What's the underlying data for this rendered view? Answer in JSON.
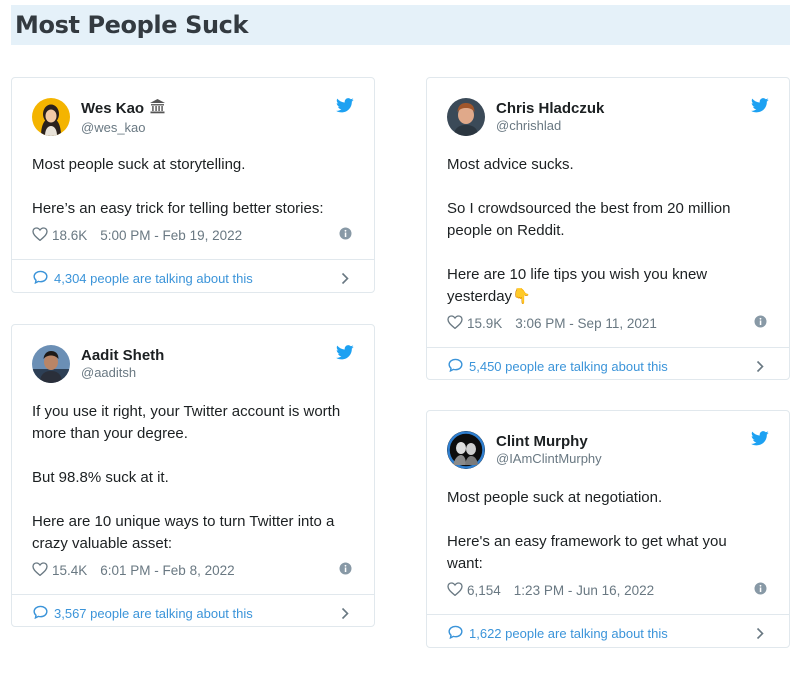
{
  "page": {
    "title": "Most People Suck"
  },
  "tweets": [
    {
      "name": "Wes Kao",
      "badge": "🏛",
      "handle": "@wes_kao",
      "lines": [
        "Most people suck at storytelling.",
        "",
        "Here’s an easy trick for telling better stories:"
      ],
      "likes": "18.6K",
      "time": "5:00 PM - Feb 19, 2022",
      "talking": "4,304 people are talking about this"
    },
    {
      "name": "Aadit Sheth",
      "handle": "@aaditsh",
      "lines": [
        "If you use it right, your Twitter account is worth",
        "more than your degree.",
        "",
        "But 98.8% suck at it.",
        "",
        "Here are 10 unique ways to turn Twitter into a",
        "crazy valuable asset:"
      ],
      "likes": "15.4K",
      "time": "6:01 PM - Feb 8, 2022",
      "talking": "3,567 people are talking about this"
    },
    {
      "name": "Chris Hladczuk",
      "handle": "@chrishlad",
      "lines": [
        "Most advice sucks.",
        "",
        "So I crowdsourced the best from 20 million",
        "people on Reddit.",
        "",
        "Here are 10 life tips you wish you knew",
        "yesterday👇"
      ],
      "likes": "15.9K",
      "time": "3:06 PM - Sep 11, 2021",
      "talking": "5,450 people are talking about this"
    },
    {
      "name": "Clint Murphy",
      "handle": "@IAmClintMurphy",
      "lines": [
        "Most people suck at negotiation.",
        "",
        "Here's an easy framework to get what you",
        "want:"
      ],
      "likes": "6,154",
      "time": "1:23 PM - Jun 16, 2022",
      "talking": "1,622 people are talking about this"
    }
  ],
  "colors": {
    "twitter_blue": "#1da1f2",
    "link_blue": "#3b94d9",
    "header_bg": "#e5f1f9"
  },
  "icons": [
    "twitter-bird-icon",
    "heart-icon",
    "info-icon",
    "speech-bubble-icon",
    "chevron-right-icon",
    "bank-emoji-icon"
  ]
}
